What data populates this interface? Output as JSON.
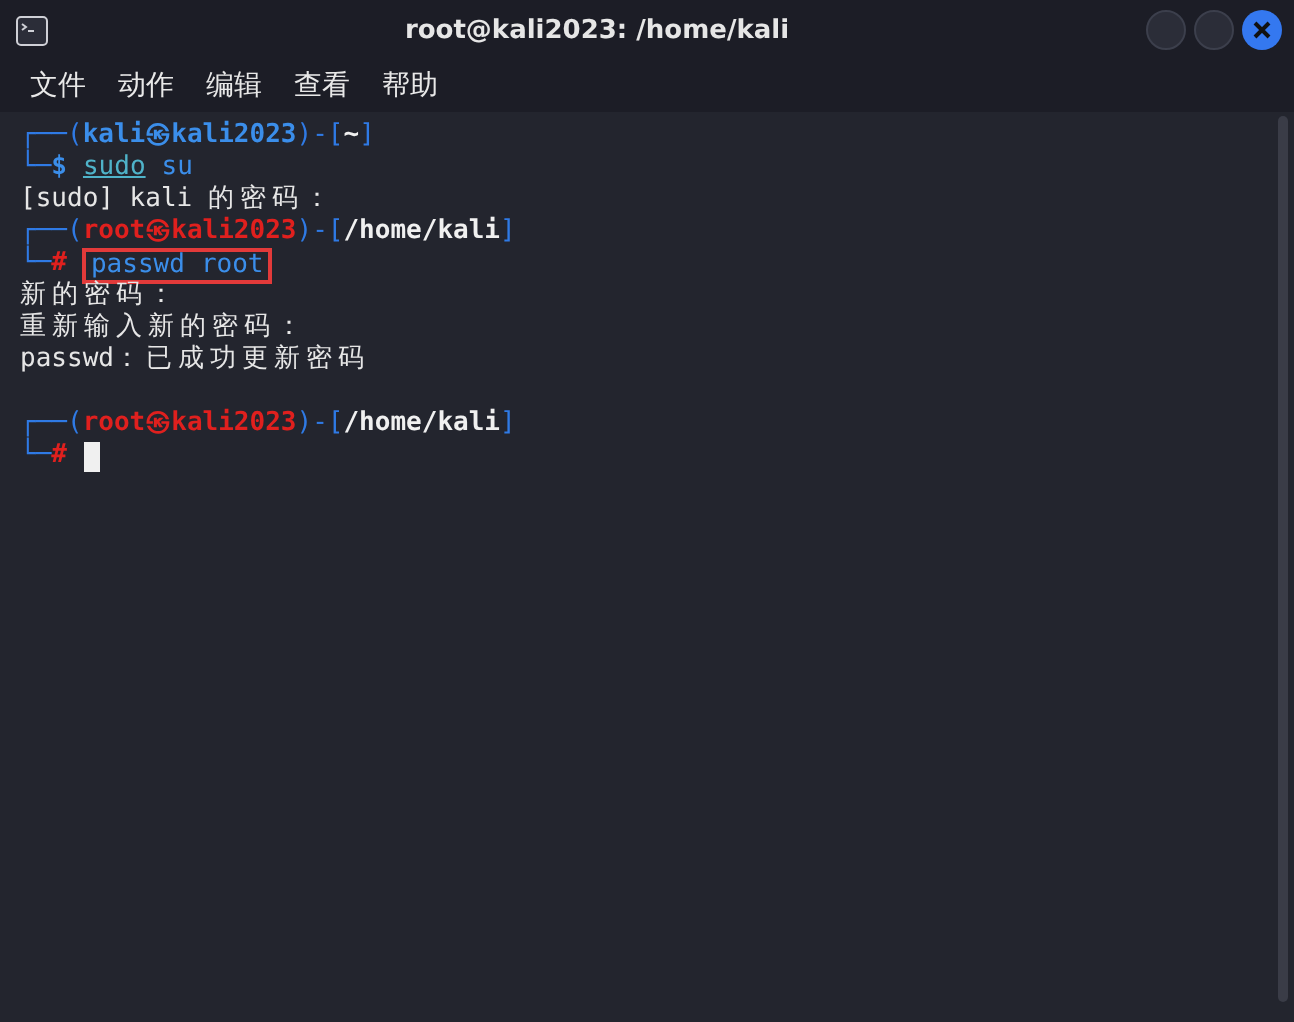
{
  "window": {
    "title": "root@kali2023: /home/kali"
  },
  "menu": [
    "文件",
    "动作",
    "编辑",
    "查看",
    "帮助"
  ],
  "terminal": {
    "lines": [
      {
        "kind": "prompt",
        "open": "┌──(",
        "user": "kali",
        "at": "㉿",
        "host": "kali2023",
        "mid": ")-[",
        "path": "~",
        "close": "]",
        "root": false
      },
      {
        "kind": "command",
        "lead": "└─",
        "symbol": "$",
        "root": false,
        "highlighted": false,
        "cursor": false,
        "words": [
          {
            "text": "sudo",
            "underlined": true
          },
          {
            "text": "su",
            "underlined": false
          }
        ]
      },
      {
        "kind": "output",
        "text": "[sudo] kali 的密码："
      },
      {
        "kind": "prompt",
        "open": "┌──(",
        "user": "root",
        "at": "㉿",
        "host": "kali2023",
        "mid": ")-[",
        "path": "/home/kali",
        "close": "]",
        "root": true
      },
      {
        "kind": "command",
        "lead": "└─",
        "symbol": "#",
        "root": true,
        "highlighted": true,
        "cursor": false,
        "words": [
          {
            "text": "passwd",
            "underlined": false
          },
          {
            "text": "root",
            "underlined": false
          }
        ]
      },
      {
        "kind": "output",
        "text": "新的密码："
      },
      {
        "kind": "output",
        "text": "重新输入新的密码："
      },
      {
        "kind": "output",
        "text": "passwd：已成功更新密码"
      },
      {
        "kind": "blank"
      },
      {
        "kind": "prompt",
        "open": "┌──(",
        "user": "root",
        "at": "㉿",
        "host": "kali2023",
        "mid": ")-[",
        "path": "/home/kali",
        "close": "]",
        "root": true
      },
      {
        "kind": "command",
        "lead": "└─",
        "symbol": "#",
        "root": true,
        "cursor": true
      }
    ]
  }
}
